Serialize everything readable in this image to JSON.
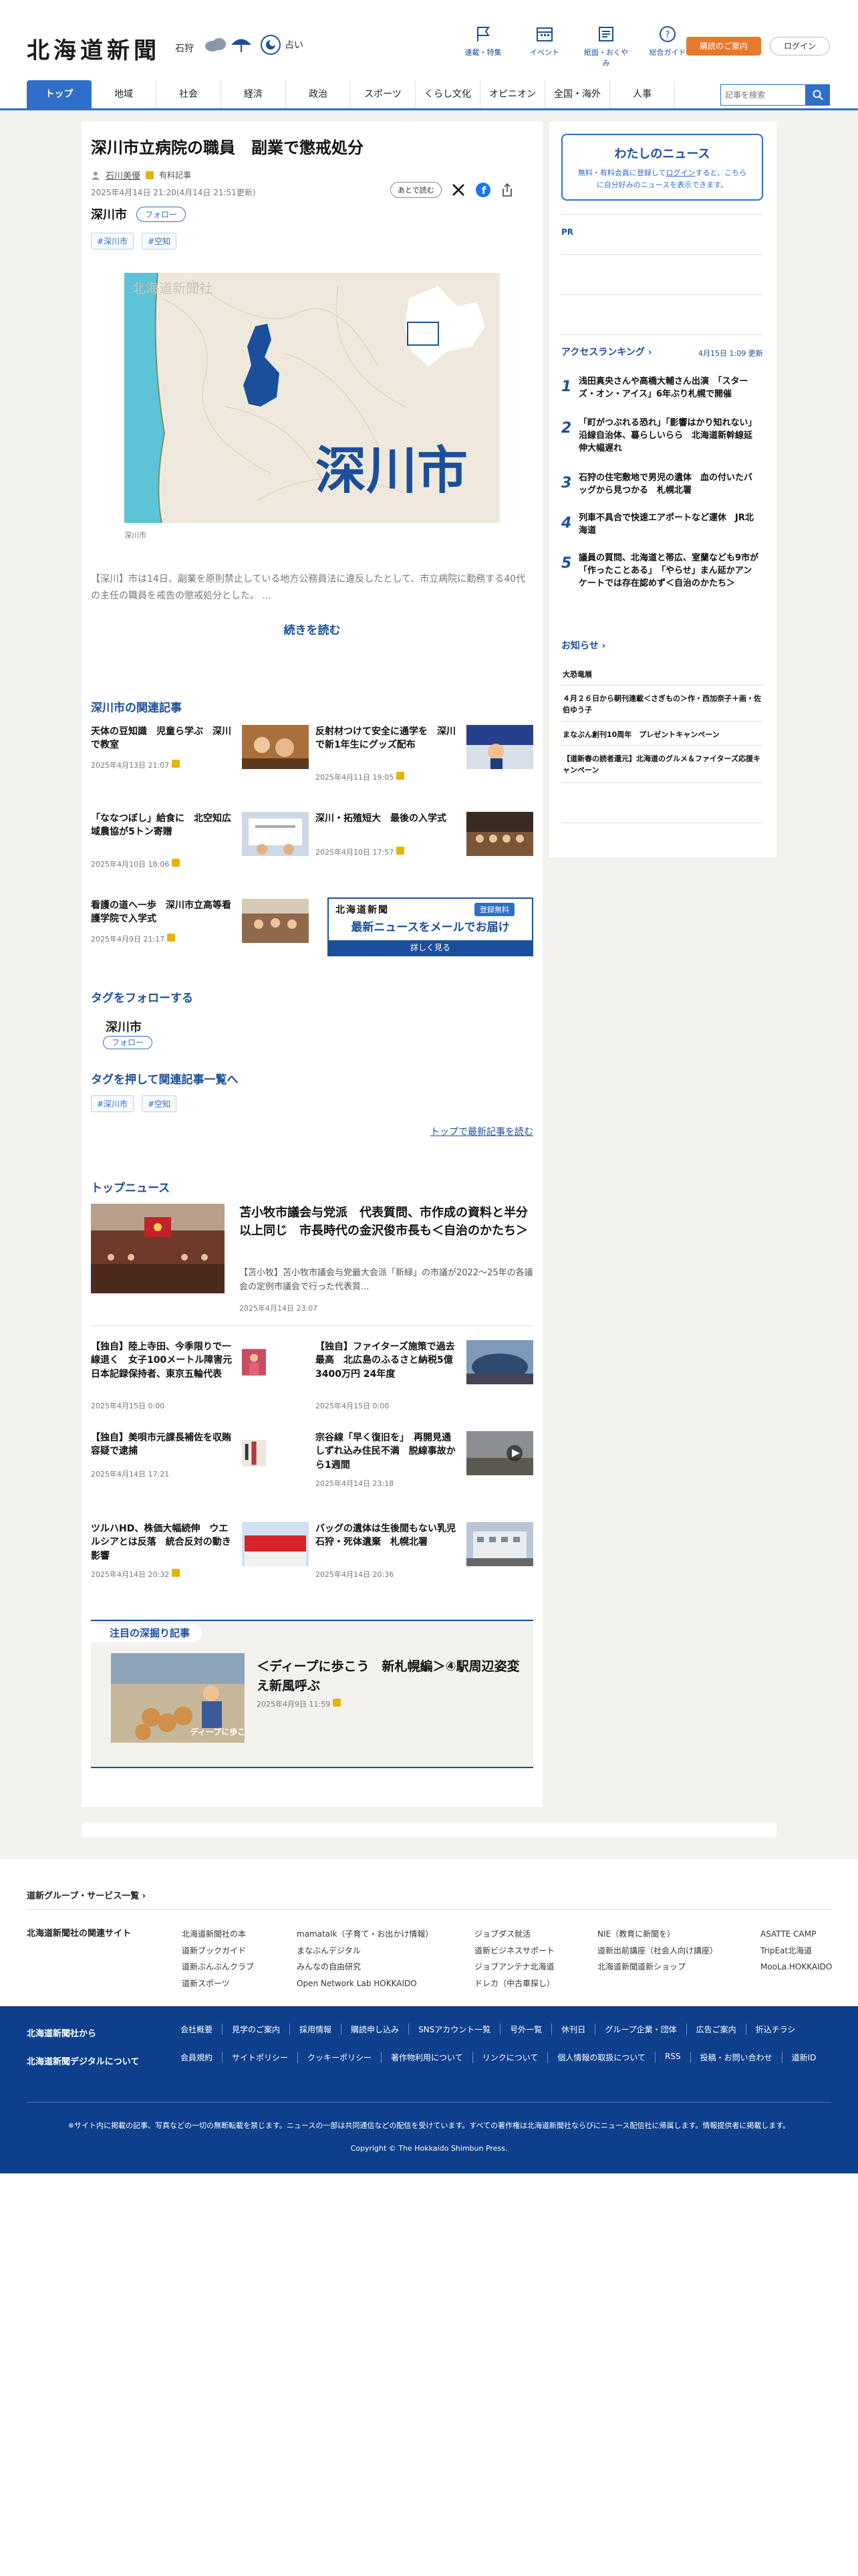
{
  "header": {
    "logo": "北海道新聞",
    "weather_city": "石狩",
    "fortune_label": "占い",
    "icons": [
      {
        "label": "連載・特集",
        "icon": "flag-icon"
      },
      {
        "label": "イベント",
        "icon": "calendar-icon"
      },
      {
        "label": "紙面・おくやみ",
        "icon": "newspaper-icon"
      },
      {
        "label": "総合ガイド",
        "icon": "question-icon"
      }
    ],
    "subscribe": "購読のご案内",
    "login": "ログイン"
  },
  "nav": {
    "items": [
      "トップ",
      "地域",
      "社会",
      "経済",
      "政治",
      "スポーツ",
      "くらし文化",
      "オピニオン",
      "全国・海外",
      "人事"
    ],
    "search_placeholder": "記事を検索"
  },
  "article": {
    "title": "深川市立病院の職員　副業で懲戒処分",
    "author": "石川美優",
    "premium": "有料記事",
    "date": "2025年4月14日 21:20(4月14日 21:51更新)",
    "later": "あとで読む",
    "tag": "深川市",
    "follow": "フォロー",
    "chips": [
      "#深川市",
      "#空知"
    ],
    "map_logo": "北海道新聞社",
    "map_label": "深川市",
    "caption": "深川市",
    "lead": "【深川】市は14日、副業を原則禁止している地方公務員法に違反したとして、市立病院に勤務する40代の主任の職員を戒告の懲戒処分とした。 ...",
    "read_more": "続きを読む"
  },
  "related": {
    "heading": "深川市の関連記事",
    "items": [
      {
        "title": "天体の豆知識　児童ら学ぶ　深川で教室",
        "date": "2025年4月13日 21:07"
      },
      {
        "title": "反射材つけて安全に通学を　深川で新1年生にグッズ配布",
        "date": "2025年4月11日 19:05"
      },
      {
        "title": "「ななつぼし」給食に　北空知広域農協が5トン寄贈",
        "date": "2025年4月10日 18:06"
      },
      {
        "title": "深川・拓殖短大　最後の入学式",
        "date": "2025年4月10日 17:57"
      },
      {
        "title": "看護の道へ一歩　深川市立高等看護学院で入学式",
        "date": "2025年4月9日 21:17"
      }
    ],
    "mail": {
      "brand": "北海道新聞",
      "badge": "登録無料",
      "headline": "最新ニュースをメールでお届け",
      "cta": "詳しく見る"
    }
  },
  "follow_tag": {
    "heading": "タグをフォローする",
    "name": "深川市",
    "button": "フォロー"
  },
  "tag_search": {
    "heading": "タグを押して関連記事一覧へ",
    "chips": [
      "#深川市",
      "#空知"
    ],
    "top_link": "トップで最新記事を読む"
  },
  "top_news": {
    "heading": "トップニュース",
    "featured": {
      "title": "苫小牧市議会与党派　代表質問、市作成の資料と半分以上同じ　市長時代の金沢俊市長も＜自治のかたち＞",
      "lead": "【苫小牧】苫小牧市議会与党最大会派「新緑」の市議が2022〜25年の各議会の定例市議会で行った代表質...",
      "date": "2025年4月14日 23:07"
    },
    "items": [
      {
        "title": "【独自】陸上寺田、今季限りで一線退く　女子100メートル障害元日本記録保持者、東京五輪代表",
        "date": "2025年4月15日 0:00"
      },
      {
        "title": "【独自】ファイターズ施策で過去最高　北広島のふるさと納税5億3400万円 24年度",
        "date": "2025年4月15日 0:00"
      },
      {
        "title": "【独自】美唄市元課長補佐を収賄容疑で逮捕",
        "date": "2025年4月14日 17:21"
      },
      {
        "title": "宗谷線「早く復旧を」　再開見通しずれ込み住民不満　脱線事故から1週間",
        "date": "2025年4月14日 23:18"
      },
      {
        "title": "ツルハHD、株価大幅続伸　ウエルシアとは反落　統合反対の動き影響",
        "date": "2025年4月14日 20:32"
      },
      {
        "title": "バッグの遺体は生後間もない乳児　石狩・死体遺棄　札幌北署",
        "date": "2025年4月14日 20:36"
      }
    ]
  },
  "deep": {
    "heading": "注目の深掘り記事",
    "title": "＜ディープに歩こう　新札幌編＞④駅周辺姿変え新風呼ぶ",
    "date": "2025年4月9日 11:59",
    "img_text": "ディープに歩こう"
  },
  "sidebar": {
    "mynews_title": "わたしのニュース",
    "mynews_desc_1": "無料・有料会員に登録して",
    "mynews_link": "ログイン",
    "mynews_desc_2": "すると、こちらに自分好みのニュースを表示できます。",
    "pr": "PR",
    "ranking_title": "アクセスランキング",
    "ranking_updated": "4月15日 1:09 更新",
    "ranking": [
      "浅田真央さんや高橋大輔さん出演　「スターズ・オン・アイス」6年ぶり札幌で開催",
      "「町がつぶれる恐れ」「影響はかり知れない」　沿線自治体、暮らしいらら　北海道新幹線延伸大幅遅れ",
      "石狩の住宅敷地で男児の遺体　血の付いたバッグから見つかる　札幌北署",
      "列車不具合で快速エアポートなど運休　JR北海道",
      "議員の質問、北海道と帯広、室蘭なども9市が「作ったことある」　「やらせ」まん延かアンケートでは存在認めず＜自治のかたち＞"
    ],
    "notice_title": "お知らせ",
    "notices": [
      "大恐竜展",
      "４月２６日から朝刊連載＜さぎもの＞作・西加奈子＋画・佐伯ゆう子",
      "まなぶん創刊10周年　プレゼントキャンペーン",
      "【道新春の読者還元】北海道のグルメ＆ファイターズ応援キャンペーン"
    ]
  },
  "footer": {
    "group": "道新グループ・サービス一覧",
    "related_head": "北海道新聞社の関連サイト",
    "col1": [
      "北海道新聞社の本",
      "道新ブックガイド",
      "道新ぶんぶんクラブ",
      "道新スポーツ"
    ],
    "col2": [
      "mamatalk（子育て・お出かけ情報）",
      "まなぶんデジタル",
      "みんなの自由研究",
      "Open Network Lab HOKKAIDO"
    ],
    "col3": [
      "ジョブダス就活",
      "道新ビジネスサポート",
      "ジョブアンテナ北海道",
      "ドレカ（中古車探し）"
    ],
    "col4": [
      "NIE（教育に新聞を）",
      "道新出前講座（社会人向け講座）",
      "北海道新聞道新ショップ"
    ],
    "col5": [
      "ASATTE CAMP",
      "TripEat北海道",
      "MooLa.HOKKAIDO"
    ],
    "about_head": "北海道新聞社から",
    "about_links": [
      "会社概要",
      "見学のご案内",
      "採用情報",
      "購読申し込み",
      "SNSアカウント一覧",
      "号外一覧",
      "休刊日",
      "グループ企業・団体",
      "広告ご案内",
      "折込チラシ"
    ],
    "digital_head": "北海道新聞デジタルについて",
    "digital_links": [
      "会員規約",
      "サイトポリシー",
      "クッキーポリシー",
      "著作物利用について",
      "リンクについて",
      "個人情報の取扱について",
      "RSS",
      "投稿・お問い合わせ",
      "道新ID"
    ],
    "notice": "※サイト内に掲載の記事、写真などの一切の無断転載を禁じます。ニュースの一部は共同通信などの配信を受けています。すべての著作権は北海道新聞社ならびにニュース配信社に帰属します。情報提供者に掲載します。",
    "copyright": "Copyright © The Hokkaido Shimbun Press."
  },
  "colors": {
    "brand": "#1b4f9c",
    "accent": "#2f6ec9",
    "subscribe": "#e8792b",
    "footer": "#0e3f8c"
  }
}
